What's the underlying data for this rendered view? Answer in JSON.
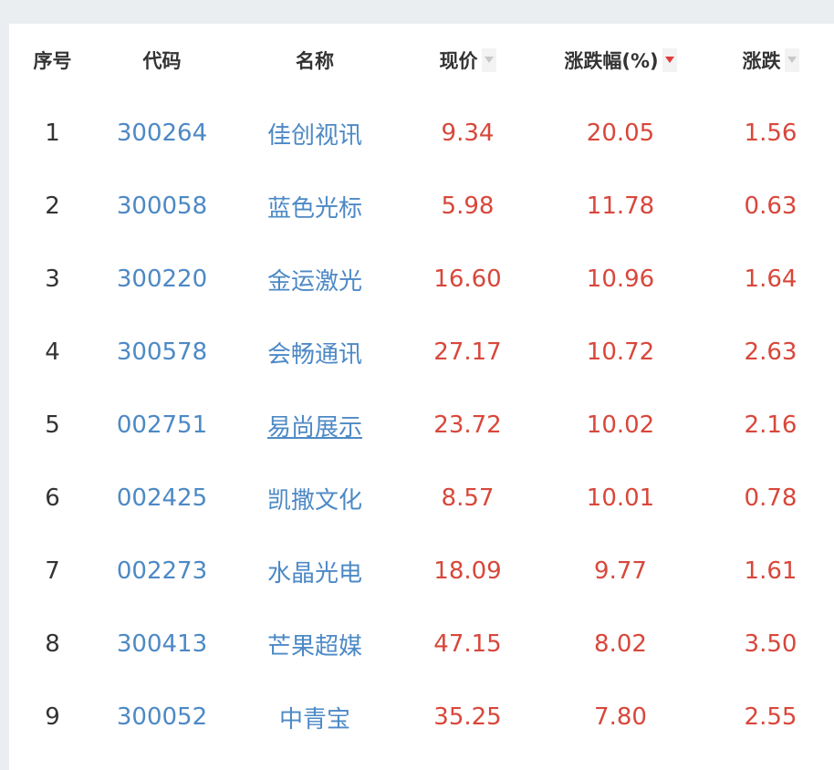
{
  "colors": {
    "page_background": "#ebeef1",
    "panel_background": "#ffffff",
    "header_text": "#333333",
    "link_blue": "#4d89c5",
    "rise_red": "#d8473b",
    "sort_active": "#e23b3b",
    "sort_inactive": "#c8c8c8"
  },
  "table": {
    "headers": {
      "index": "序号",
      "code": "代码",
      "name": "名称",
      "price": "现价",
      "change_pct": "涨跌幅(%)",
      "change": "涨跌"
    },
    "sort": {
      "column": "change_pct",
      "direction": "descending",
      "icon": "sort-down-icon"
    },
    "rows": [
      {
        "index": "1",
        "code": "300264",
        "name": "佳创视讯",
        "price": "9.34",
        "change_pct": "20.05",
        "change": "1.56",
        "hovered": false
      },
      {
        "index": "2",
        "code": "300058",
        "name": "蓝色光标",
        "price": "5.98",
        "change_pct": "11.78",
        "change": "0.63",
        "hovered": false
      },
      {
        "index": "3",
        "code": "300220",
        "name": "金运激光",
        "price": "16.60",
        "change_pct": "10.96",
        "change": "1.64",
        "hovered": false
      },
      {
        "index": "4",
        "code": "300578",
        "name": "会畅通讯",
        "price": "27.17",
        "change_pct": "10.72",
        "change": "2.63",
        "hovered": false
      },
      {
        "index": "5",
        "code": "002751",
        "name": "易尚展示",
        "price": "23.72",
        "change_pct": "10.02",
        "change": "2.16",
        "hovered": true
      },
      {
        "index": "6",
        "code": "002425",
        "name": "凯撒文化",
        "price": "8.57",
        "change_pct": "10.01",
        "change": "0.78",
        "hovered": false
      },
      {
        "index": "7",
        "code": "002273",
        "name": "水晶光电",
        "price": "18.09",
        "change_pct": "9.77",
        "change": "1.61",
        "hovered": false
      },
      {
        "index": "8",
        "code": "300413",
        "name": "芒果超媒",
        "price": "47.15",
        "change_pct": "8.02",
        "change": "3.50",
        "hovered": false
      },
      {
        "index": "9",
        "code": "300052",
        "name": "中青宝",
        "price": "35.25",
        "change_pct": "7.80",
        "change": "2.55",
        "hovered": false
      }
    ]
  }
}
